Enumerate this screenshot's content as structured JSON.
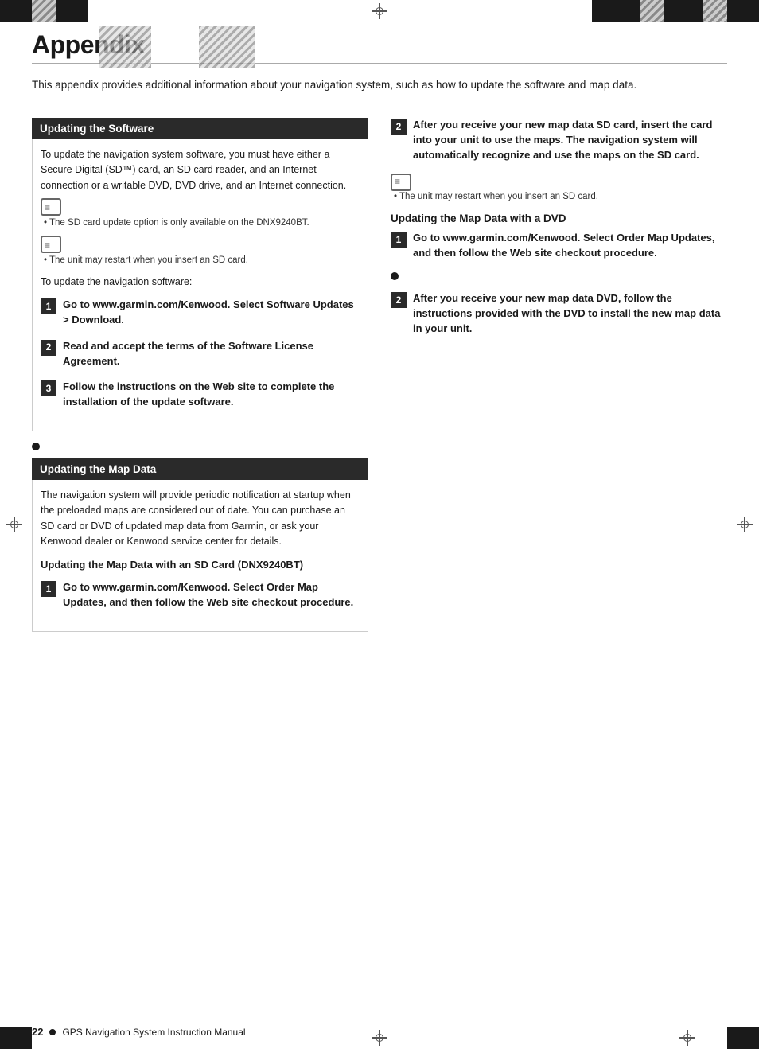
{
  "page": {
    "title": "Appendix",
    "intro": "This appendix provides additional information about your navigation system, such as how to update the software and map data.",
    "footer": {
      "page_number": "22",
      "bullet": "●",
      "text": "GPS Navigation System Instruction Manual"
    }
  },
  "left_column": {
    "software_section": {
      "header": "Updating the Software",
      "body": "To update the navigation system software, you must have either a Secure Digital (SD™) card, an SD card reader, and an Internet connection or a writable DVD, DVD drive, and an Internet connection.",
      "note1": "The SD card update option is only available on the DNX9240BT.",
      "note2": "The unit may restart when you insert an SD card.",
      "to_update_label": "To update the navigation software:",
      "steps": [
        {
          "num": "1",
          "text": "Go to www.garmin.com/Kenwood. Select Software Updates > Download."
        },
        {
          "num": "2",
          "text": "Read and accept the terms of the Software License Agreement."
        },
        {
          "num": "3",
          "text": "Follow the instructions on the Web site to complete the installation of the update software."
        }
      ]
    },
    "map_section": {
      "header": "Updating the Map Data",
      "body": "The navigation system will provide periodic notification at startup when the preloaded maps are considered out of date. You can purchase an SD card or DVD of updated map data from Garmin, or ask your Kenwood dealer or Kenwood service center for details.",
      "sd_card_heading": "Updating the Map Data with an SD Card (DNX9240BT)",
      "sd_steps": [
        {
          "num": "1",
          "text": "Go to www.garmin.com/Kenwood. Select Order Map Updates, and then follow the Web site checkout procedure."
        }
      ]
    }
  },
  "right_column": {
    "after_sd_step": {
      "num": "2",
      "text": "After you receive your new map data SD card, insert the card into your unit to use the maps. The navigation system will automatically recognize and use the maps on the SD card."
    },
    "note_sd": "The unit may restart when you insert an SD card.",
    "dvd_heading": "Updating the Map Data with a DVD",
    "dvd_steps": [
      {
        "num": "1",
        "text": "Go to www.garmin.com/Kenwood. Select Order Map Updates, and then follow the Web site checkout procedure."
      },
      {
        "num": "2",
        "text": "After you receive your new map data DVD, follow the instructions provided with the DVD to install the new map data in your unit."
      }
    ]
  }
}
